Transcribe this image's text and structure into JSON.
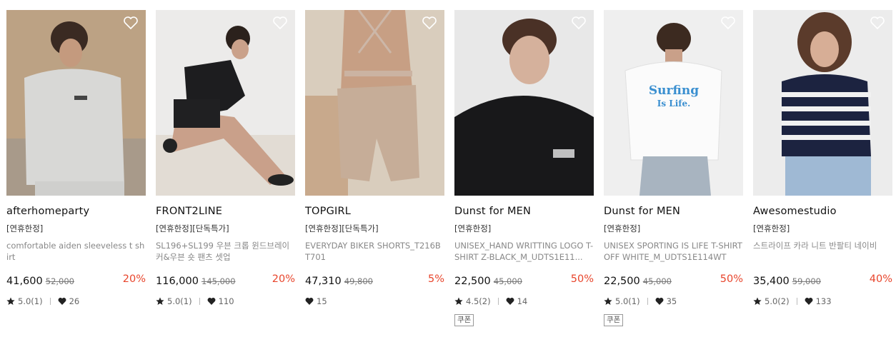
{
  "colors": {
    "discount": "#e8452c",
    "text": "#111111",
    "muted": "#888888"
  },
  "icons": {
    "wishlist": "heart-outline-icon",
    "rating": "star-icon",
    "likes": "heart-icon"
  },
  "products": [
    {
      "brand": "afterhomeparty",
      "tag": "[연휴한정]",
      "name": "comfortable aiden sleeveless t shirt",
      "price": "41,600",
      "original_price": "52,000",
      "discount": "20%",
      "rating": "5.0(1)",
      "likes": "26",
      "coupon": ""
    },
    {
      "brand": "FRONT2LINE",
      "tag": "[연휴한정][단독특가]",
      "name": "SL196+SL199 우븐 크롭 윈드브레이커&우븐 숏 팬츠 셋업",
      "price": "116,000",
      "original_price": "145,000",
      "discount": "20%",
      "rating": "5.0(1)",
      "likes": "110",
      "coupon": ""
    },
    {
      "brand": "TOPGIRL",
      "tag": "[연휴한정][단독특가]",
      "name": "EVERYDAY BIKER SHORTS_T216BT701",
      "price": "47,310",
      "original_price": "49,800",
      "discount": "5%",
      "rating": "",
      "likes": "15",
      "coupon": ""
    },
    {
      "brand": "Dunst for MEN",
      "tag": "[연휴한정]",
      "name": "UNISEX_HAND WRITTING LOGO T-SHIRT Z-BLACK_M_UDTS1E11...",
      "price": "22,500",
      "original_price": "45,000",
      "discount": "50%",
      "rating": "4.5(2)",
      "likes": "14",
      "coupon": "쿠폰"
    },
    {
      "brand": "Dunst for MEN",
      "tag": "[연휴한정]",
      "name": "UNISEX SPORTING IS LIFE T-SHIRT OFF WHITE_M_UDTS1E114WT",
      "price": "22,500",
      "original_price": "45,000",
      "discount": "50%",
      "rating": "5.0(1)",
      "likes": "35",
      "coupon": "쿠폰"
    },
    {
      "brand": "Awesomestudio",
      "tag": "[연휴한정]",
      "name": "스트라이프 카라 니트 반팔티 네이비",
      "price": "35,400",
      "original_price": "59,000",
      "discount": "40%",
      "rating": "5.0(2)",
      "likes": "133",
      "coupon": ""
    }
  ],
  "image_text": {
    "shirt_print_line1": "Surfing",
    "shirt_print_line2": "Is Life."
  }
}
